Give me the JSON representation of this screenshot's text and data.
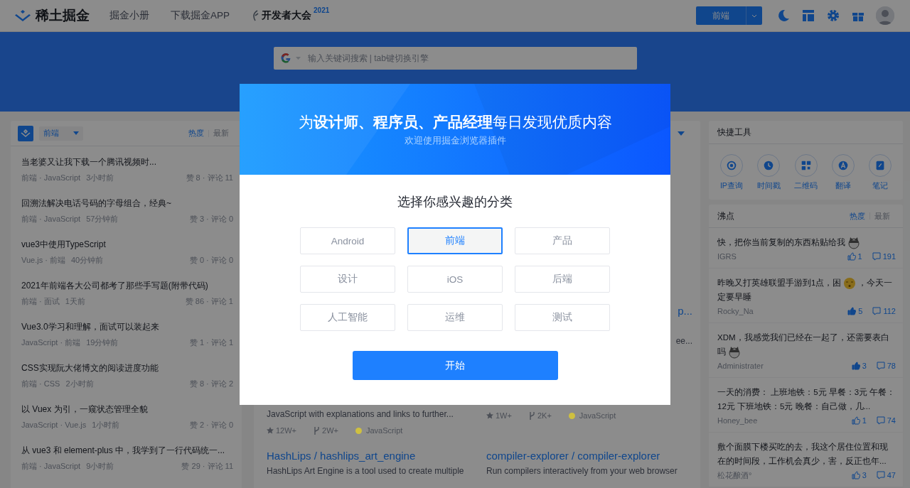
{
  "header": {
    "logo": "稀土掘金",
    "nav": [
      {
        "label": "掘金小册"
      },
      {
        "label": "下载掘金APP"
      },
      {
        "label": "开发者大会",
        "sup": "2021"
      }
    ],
    "category_button": "前端"
  },
  "search": {
    "placeholder": "输入关键词搜索 | tab键切换引擎"
  },
  "feed": {
    "category": "前端",
    "tabs": [
      {
        "label": "热度",
        "selected": true
      },
      {
        "label": "最新",
        "selected": false
      }
    ],
    "articles": [
      {
        "title": "当老婆又让我下载一个腾讯视频时...",
        "tags": "前端 · JavaScript",
        "time": "3小时前",
        "stats": "赞 8 · 评论 11"
      },
      {
        "title": "回溯法解决电话号码的字母组合，经典~",
        "tags": "前端 · JavaScript",
        "time": "57分钟前",
        "stats": "赞 3 · 评论 0"
      },
      {
        "title": "vue3中使用TypeScript",
        "tags": "Vue.js · 前端",
        "time": "40分钟前",
        "stats": "赞 0 · 评论 0"
      },
      {
        "title": "2021年前端各大公司都考了那些手写题(附带代码)",
        "tags": "前端 · 面试",
        "time": "1天前",
        "stats": "赞 86 · 评论 1"
      },
      {
        "title": "Vue3.0学习和理解，面试可以装起来",
        "tags": "JavaScript · 前端",
        "time": "19分钟前",
        "stats": "赞 1 · 评论 1"
      },
      {
        "title": "CSS实现阮大佬博文的阅读进度功能",
        "tags": "前端 · CSS",
        "time": "2小时前",
        "stats": "赞 8 · 评论 2"
      },
      {
        "title": "以 Vuex 为引，一窥状态管理全貌",
        "tags": "JavaScript · Vue.js",
        "time": "1小时前",
        "stats": "赞 2 · 评论 0"
      },
      {
        "title": "从 vue3 和 element-plus 中，我学到了一行代码统一...",
        "tags": "前端 · JavaScript",
        "time": "9小时前",
        "stats": "赞 29 · 评论 11"
      }
    ]
  },
  "repo_rows": [
    {
      "right": {
        "title": "p...",
        "description": "ee..."
      }
    },
    {
      "left": {
        "description": "JavaScript with explanations and links to further...",
        "star_count": "12W+",
        "fork_count": "2W+",
        "language": "JavaScript",
        "color": "#cfc040"
      },
      "right": {
        "star_count": "1W+",
        "fork_count": "2K+",
        "language": "JavaScript",
        "color": "#cfc040"
      }
    },
    {
      "left": {
        "title": "HashLips / hashlips_art_engine",
        "description": "HashLips Art Engine is a tool used to create multiple"
      },
      "right": {
        "title": "compiler-explorer / compiler-explorer",
        "description": "Run compilers interactively from your web browser"
      }
    }
  ],
  "tools": {
    "title": "快捷工具",
    "items": [
      {
        "label": "IP查询"
      },
      {
        "label": "时间戳"
      },
      {
        "label": "二维码"
      },
      {
        "label": "翻译"
      },
      {
        "label": "笔记"
      }
    ]
  },
  "pins": {
    "title": "沸点",
    "tabs": [
      {
        "label": "热度",
        "selected": true
      },
      {
        "label": "最新",
        "selected": false
      }
    ],
    "posts": [
      {
        "segments": [
          {
            "kind": "text",
            "text": "快，把你当前复制的东西粘贴给我"
          },
          {
            "kind": "dog"
          }
        ],
        "author": "IGRS",
        "liked": false,
        "likes": "1",
        "comments": "191"
      },
      {
        "segments": [
          {
            "kind": "text",
            "text": "昨晚又打英雄联盟手游到1点，困"
          },
          {
            "kind": "sleepy"
          },
          {
            "kind": "text",
            "text": "，今天一"
          },
          {
            "kind": "text",
            "text": "定要早睡"
          }
        ],
        "author": "Rocky_Na",
        "liked": true,
        "likes": "5",
        "comments": "112"
      },
      {
        "segments": [
          {
            "kind": "text",
            "text": "XDM，我感觉我们已经在一起了，还需要表白"
          },
          {
            "kind": "text",
            "text": "吗"
          },
          {
            "kind": "dog"
          }
        ],
        "author": "Administrater",
        "liked": true,
        "likes": "3",
        "comments": "78"
      },
      {
        "segments": [
          {
            "kind": "text",
            "text": "一天的消费： 上班地铁：5元 早餐：3元 午餐：12元 下班地铁：5元 晚餐：自己做，几..."
          }
        ],
        "author": "Honey_bee",
        "liked": false,
        "likes": "1",
        "comments": "74"
      },
      {
        "segments": [
          {
            "kind": "text",
            "text": "敷个面膜下楼买吃的去，我这个居住位置和现在的时间段，工作机会真少，害，反正也年..."
          }
        ],
        "author": "松花酿酒°",
        "liked": false,
        "likes": "3",
        "comments": "47"
      }
    ]
  },
  "modal": {
    "title": "为**设计师、程序员、产品经理**每日发现优质内容",
    "subtitle": "欢迎使用掘金浏览器插件",
    "heading": "选择你感兴趣的分类",
    "categories": [
      {
        "label": "Android",
        "selected": false
      },
      {
        "label": "前端",
        "selected": true
      },
      {
        "label": "产品",
        "selected": false
      },
      {
        "label": "设计",
        "selected": false
      },
      {
        "label": "iOS",
        "selected": false
      },
      {
        "label": "后端",
        "selected": false
      },
      {
        "label": "人工智能",
        "selected": false
      },
      {
        "label": "运维",
        "selected": false
      },
      {
        "label": "测试",
        "selected": false
      }
    ],
    "button": "开始"
  }
}
